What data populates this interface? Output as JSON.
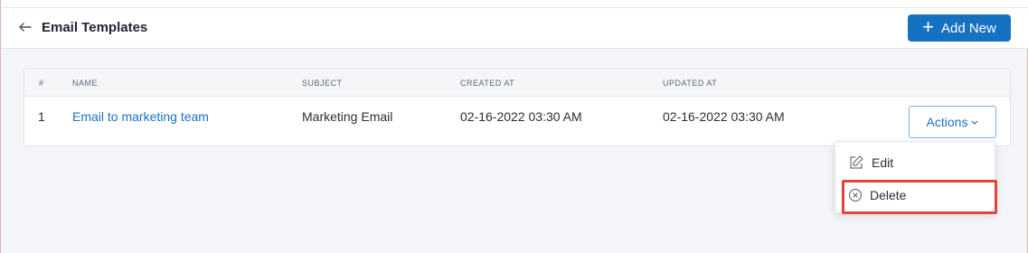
{
  "header": {
    "title": "Email Templates",
    "add_button_label": "Add New"
  },
  "table": {
    "columns": [
      "#",
      "NAME",
      "SUBJECT",
      "CREATED AT",
      "UPDATED AT"
    ],
    "rows": [
      {
        "index": "1",
        "name": "Email to marketing team",
        "subject": "Marketing Email",
        "created_at": "02-16-2022 03:30 AM",
        "updated_at": "02-16-2022 03:30 AM",
        "actions_label": "Actions"
      }
    ]
  },
  "actions_menu": {
    "items": [
      {
        "label": "Edit",
        "icon": "edit-icon"
      },
      {
        "label": "Delete",
        "icon": "delete-circle-x-icon"
      }
    ]
  },
  "colors": {
    "primary": "#1571c2",
    "link": "#1a73c2",
    "highlight": "#e0443b",
    "background": "#f4f5f8"
  }
}
